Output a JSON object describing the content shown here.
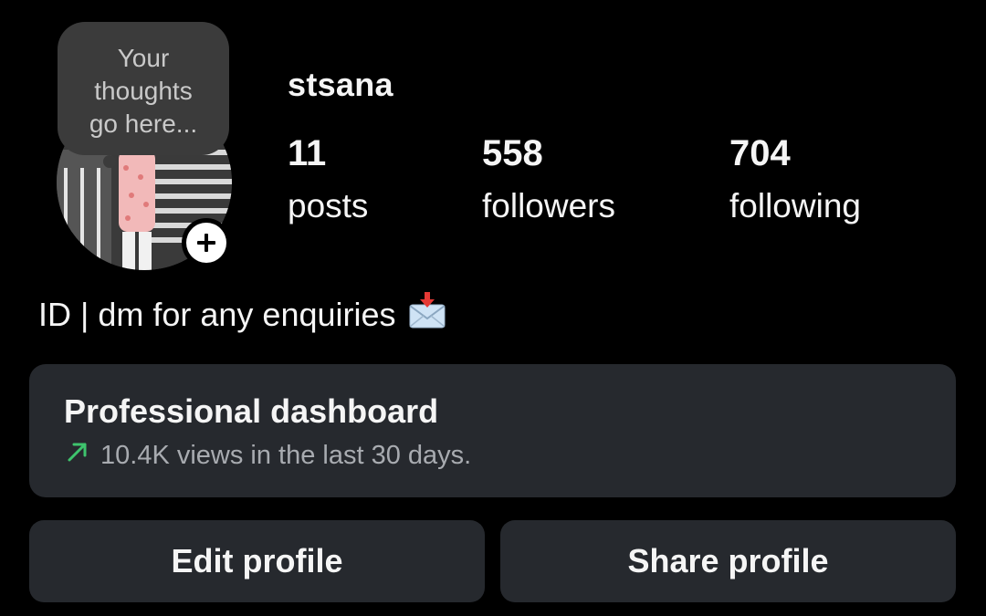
{
  "profile": {
    "note_placeholder": "Your thoughts go here...",
    "username": "stsana",
    "bio": "ID | dm for any enquiries",
    "bio_emoji_icon": "incoming-envelope-icon",
    "add_icon": "plus-icon"
  },
  "stats": [
    {
      "count": "11",
      "label": "posts"
    },
    {
      "count": "558",
      "label": "followers"
    },
    {
      "count": "704",
      "label": "following"
    }
  ],
  "dashboard": {
    "title": "Professional dashboard",
    "subtitle": "10.4K views in the last 30 days.",
    "trend_icon": "trend-up-arrow-icon",
    "trend_color": "#3ec46d"
  },
  "actions": {
    "edit_label": "Edit profile",
    "share_label": "Share profile"
  },
  "colors": {
    "background": "#000000",
    "card": "#26292e",
    "note_bubble": "#3b3b3b",
    "text_primary": "#f5f5f5",
    "text_secondary": "#a8abb0"
  }
}
